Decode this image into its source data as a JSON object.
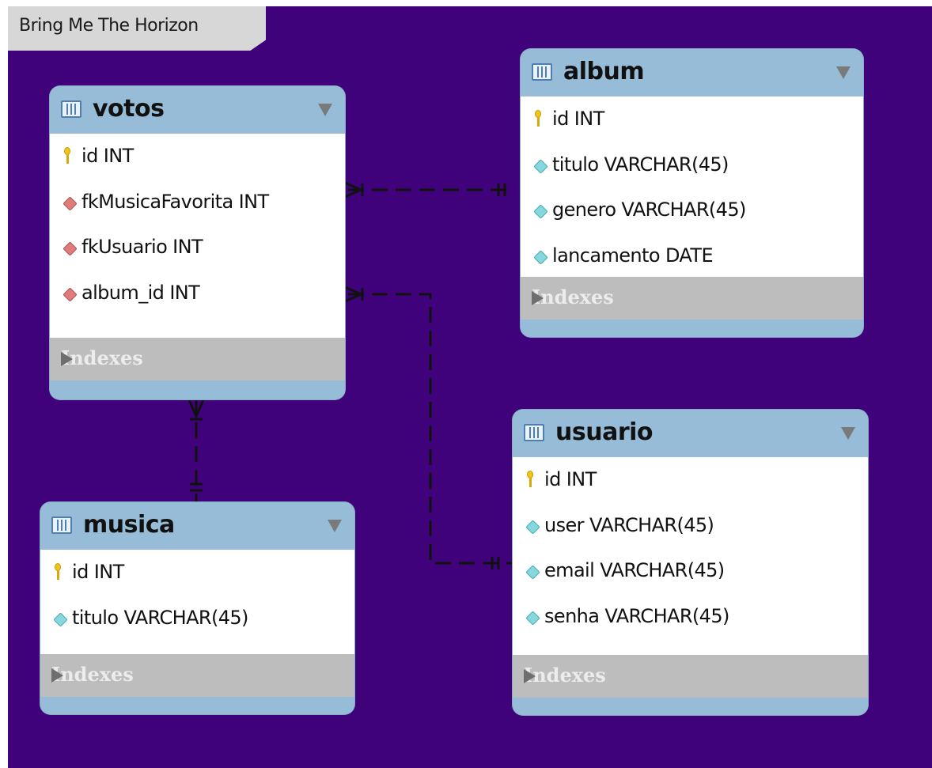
{
  "diagram": {
    "group_title": "Bring Me The Horizon",
    "indexes_label": "Indexes",
    "tables": {
      "votos": {
        "name": "votos",
        "columns": [
          {
            "text": "id INT",
            "icon": "primary-key-icon"
          },
          {
            "text": "fkMusicaFavorita INT",
            "icon": "foreign-key-icon"
          },
          {
            "text": "fkUsuario INT",
            "icon": "foreign-key-icon"
          },
          {
            "text": "album_id INT",
            "icon": "foreign-key-icon"
          }
        ]
      },
      "album": {
        "name": "album",
        "columns": [
          {
            "text": "id INT",
            "icon": "primary-key-icon"
          },
          {
            "text": "titulo VARCHAR(45)",
            "icon": "column-icon"
          },
          {
            "text": "genero VARCHAR(45)",
            "icon": "column-icon"
          },
          {
            "text": "lancamento DATE",
            "icon": "column-icon"
          }
        ]
      },
      "usuario": {
        "name": "usuario",
        "columns": [
          {
            "text": "id INT",
            "icon": "primary-key-icon"
          },
          {
            "text": "user VARCHAR(45)",
            "icon": "column-icon"
          },
          {
            "text": "email VARCHAR(45)",
            "icon": "column-icon"
          },
          {
            "text": "senha VARCHAR(45)",
            "icon": "column-icon"
          }
        ]
      },
      "musica": {
        "name": "musica",
        "columns": [
          {
            "text": "id INT",
            "icon": "primary-key-icon"
          },
          {
            "text": "titulo VARCHAR(45)",
            "icon": "column-icon"
          }
        ]
      }
    },
    "relationships": [
      {
        "from": "votos",
        "to": "album",
        "type": "many-to-one"
      },
      {
        "from": "votos",
        "to": "usuario",
        "type": "many-to-one"
      },
      {
        "from": "votos",
        "to": "musica",
        "type": "many-to-one"
      }
    ],
    "colors": {
      "canvas": "#3f027a",
      "entity_header": "#97bcd8",
      "indexes_bar": "#bdbdbd",
      "line": "#111111"
    }
  }
}
